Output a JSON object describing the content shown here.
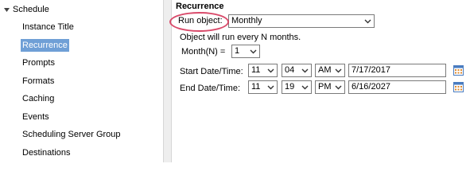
{
  "nav": {
    "root_label": "Schedule",
    "items": [
      {
        "label": "Instance Title",
        "selected": false
      },
      {
        "label": "Recurrence",
        "selected": true
      },
      {
        "label": "Prompts",
        "selected": false
      },
      {
        "label": "Formats",
        "selected": false
      },
      {
        "label": "Caching",
        "selected": false
      },
      {
        "label": "Events",
        "selected": false
      },
      {
        "label": "Scheduling Server Group",
        "selected": false
      },
      {
        "label": "Destinations",
        "selected": false
      }
    ]
  },
  "recurrence": {
    "title": "Recurrence",
    "run_object_label": "Run object:",
    "run_object_value": "Monthly",
    "description": "Object will run every N months.",
    "month_n_label": "Month(N) =",
    "month_n_value": "1",
    "start": {
      "label": "Start Date/Time:",
      "hour": "11",
      "minute": "04",
      "ampm": "AM",
      "date": "7/17/2017"
    },
    "end": {
      "label": "End Date/Time:",
      "hour": "11",
      "minute": "19",
      "ampm": "PM",
      "date": "6/16/2027"
    }
  },
  "colors": {
    "selected_bg": "#6f9fd6",
    "highlight": "#d94a6a"
  }
}
